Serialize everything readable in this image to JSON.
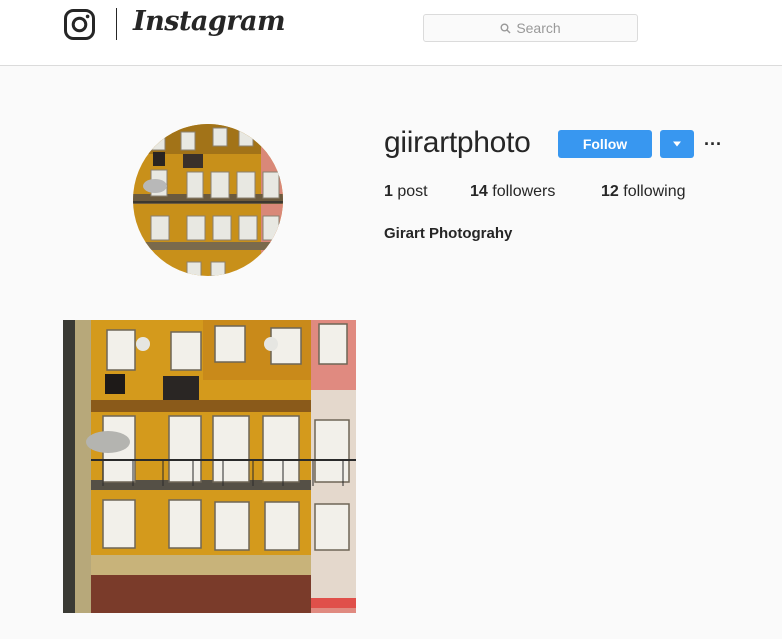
{
  "header": {
    "wordmark": "Instagram",
    "search_placeholder": "Search"
  },
  "profile": {
    "username": "giirartphoto",
    "follow_label": "Follow",
    "more_label": "···",
    "stats": [
      {
        "count": "1",
        "label": "post"
      },
      {
        "count": "14",
        "label": "followers"
      },
      {
        "count": "12",
        "label": "following"
      }
    ],
    "full_name": "Girart Photograhy"
  },
  "colors": {
    "accent": "#3897f0",
    "background": "#fafafa",
    "text": "#262626"
  },
  "icons": {
    "logo": "instagram-camera-icon",
    "search": "search-icon",
    "dropdown": "caret-down-icon",
    "more": "ellipsis-icon"
  },
  "posts": [
    {
      "description": "photo"
    }
  ]
}
